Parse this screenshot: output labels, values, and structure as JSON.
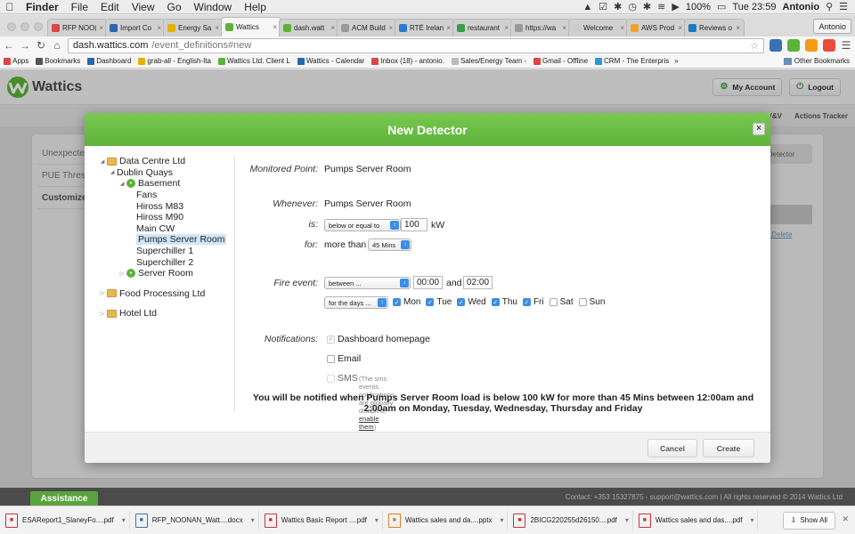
{
  "menubar": {
    "app": "Finder",
    "items": [
      "File",
      "Edit",
      "View",
      "Go",
      "Window",
      "Help"
    ],
    "battery": "100%",
    "clock": "Tue 23:59",
    "user": "Antonio"
  },
  "tabs": [
    {
      "title": "RFP NOO(",
      "color": "#d44"
    },
    {
      "title": "Import Co",
      "color": "#2a66b0"
    },
    {
      "title": "Energy Sa",
      "color": "#e6b000"
    },
    {
      "title": "Wattics",
      "color": "#5cb33a",
      "active": true
    },
    {
      "title": "dash.watt",
      "color": "#5cb33a"
    },
    {
      "title": "ACM Build",
      "color": "#999"
    },
    {
      "title": "RTÉ Irelan",
      "color": "#2a7bd6"
    },
    {
      "title": "restaurant",
      "color": "#3a9b4a"
    },
    {
      "title": "https://wa",
      "color": "#999"
    },
    {
      "title": "Welcome",
      "color": "#ccc"
    },
    {
      "title": "AWS Prod",
      "color": "#f0a030"
    },
    {
      "title": "Reviews o",
      "color": "#1e7ac0"
    }
  ],
  "profile": "Antonio",
  "address": {
    "host": "dash.wattics.com",
    "path": "/event_definitions#new"
  },
  "bookmarks": [
    {
      "label": "Apps",
      "color": "#d44"
    },
    {
      "label": "Bookmarks",
      "color": "#555"
    },
    {
      "label": "Dashboard",
      "color": "#2a66b0"
    },
    {
      "label": "grab-all - English-Ita",
      "color": "#e6b000"
    },
    {
      "label": "Wattics Ltd. Client L",
      "color": "#5cb33a"
    },
    {
      "label": "Wattics - Calendar",
      "color": "#2a66b0"
    },
    {
      "label": "Inbox (18) - antonio.",
      "color": "#d44"
    },
    {
      "label": "Sales/Energy Team -",
      "color": "#bbb"
    },
    {
      "label": "Gmail - Offline",
      "color": "#d44"
    },
    {
      "label": "CRM - The Enterpris",
      "color": "#2a9ad6"
    }
  ],
  "bookmarks_more": "»",
  "bookmarks_other": "Other Bookmarks",
  "app": {
    "logo_text": "Wattics",
    "my_account": "My Account",
    "logout": "Logout",
    "nav_items": [
      "V&V",
      "Actions Tracker"
    ]
  },
  "background": {
    "left_nav": [
      "Unexpected",
      "PUE Thresh",
      "Customize"
    ],
    "detector_btn": "Detector",
    "delete_link": "| Delete"
  },
  "modal": {
    "title": "New Detector",
    "tree": [
      {
        "label": "Data Centre Ltd",
        "level": 0,
        "type": "folder",
        "open": true
      },
      {
        "label": "Dublin Quays",
        "level": 1,
        "type": "plain",
        "open": true
      },
      {
        "label": "Basement",
        "level": 2,
        "type": "dot",
        "open": true
      },
      {
        "label": "Fans",
        "level": 3,
        "type": "leaf"
      },
      {
        "label": "Hiross M83",
        "level": 3,
        "type": "leaf"
      },
      {
        "label": "Hiross M90",
        "level": 3,
        "type": "leaf"
      },
      {
        "label": "Main CW",
        "level": 3,
        "type": "leaf"
      },
      {
        "label": "Pumps Server Room",
        "level": 3,
        "type": "leaf",
        "selected": true
      },
      {
        "label": "Superchiller 1",
        "level": 3,
        "type": "leaf"
      },
      {
        "label": "Superchiller 2",
        "level": 3,
        "type": "leaf"
      },
      {
        "label": "Server Room",
        "level": 2,
        "type": "dot",
        "open": false
      },
      {
        "label": "",
        "level": 0,
        "type": "spacer"
      },
      {
        "label": "Food Processing Ltd",
        "level": 0,
        "type": "folder",
        "open": false
      },
      {
        "label": "",
        "level": 0,
        "type": "spacer"
      },
      {
        "label": "Hotel Ltd",
        "level": 0,
        "type": "folder",
        "open": false
      }
    ],
    "labels": {
      "monitored_point": "Monitored Point:",
      "whenever": "Whenever:",
      "is": "is:",
      "for": "for:",
      "fire_event": "Fire event:",
      "notifications": "Notifications:"
    },
    "monitored_point": "Pumps Server Room",
    "whenever": "Pumps Server Room",
    "condition": "below or equal to",
    "threshold": "100",
    "unit": "kW",
    "more_than": "more than",
    "duration": "45 Mins",
    "fire_mode": "between ...",
    "time_from": "00:00",
    "and": "and",
    "time_to": "02:00",
    "days_mode": "for the days ...",
    "days": [
      {
        "label": "Mon",
        "checked": true
      },
      {
        "label": "Tue",
        "checked": true
      },
      {
        "label": "Wed",
        "checked": true
      },
      {
        "label": "Thu",
        "checked": true
      },
      {
        "label": "Fri",
        "checked": true
      },
      {
        "label": "Sat",
        "checked": false
      },
      {
        "label": "Sun",
        "checked": false
      }
    ],
    "notif_dashboard": "Dashboard homepage",
    "notif_email": "Email",
    "notif_sms": "SMS",
    "sms_note": "(The sms events notifications are globally disabled,",
    "sms_link": "enable them",
    "sms_note_end": ")",
    "summary_line1": "You will be notified when Pumps Server Room load is below 100 kW for more than 45 Mins between 12:00am and",
    "summary_line2": "2:00am on Monday, Tuesday, Wednesday, Thursday and Friday",
    "cancel": "Cancel",
    "create": "Create"
  },
  "footer": {
    "assistance": "Assistance",
    "contact": "Contact: +353 15327875 - support@wattics.com | All rights reserved © 2014 Wattics Ltd"
  },
  "downloads": [
    {
      "name": "ESAReport1_SlaneyFo....pdf",
      "kind": "pdf"
    },
    {
      "name": "RFP_NOONAN_Watt....docx",
      "kind": "doc"
    },
    {
      "name": "Wattics Basic Report ....pdf",
      "kind": "pdf"
    },
    {
      "name": "Wattics sales and da....pptx",
      "kind": "ppt"
    },
    {
      "name": "2BICG220255d26150....pdf",
      "kind": "pdf"
    },
    {
      "name": "Wattics sales and das....pdf",
      "kind": "pdf"
    }
  ],
  "show_all": "Show All"
}
